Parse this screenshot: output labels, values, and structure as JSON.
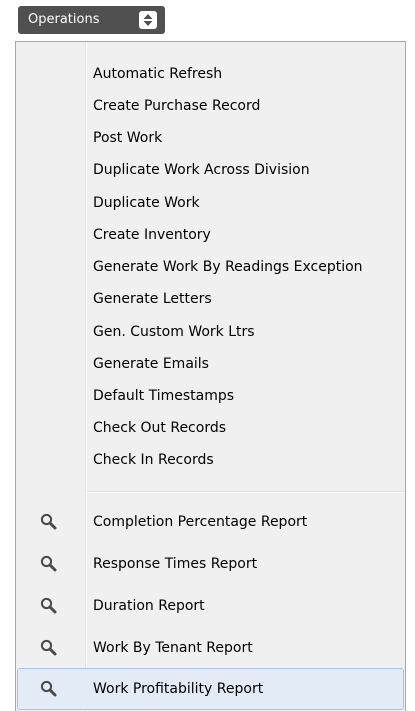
{
  "operations_button": {
    "label": "Operations",
    "icon": "updown-arrows-icon"
  },
  "menu": {
    "actions": [
      {
        "label": "Automatic Refresh"
      },
      {
        "label": "Create Purchase Record"
      },
      {
        "label": "Post Work"
      },
      {
        "label": "Duplicate Work Across Division"
      },
      {
        "label": "Duplicate Work"
      },
      {
        "label": "Create Inventory"
      },
      {
        "label": "Generate Work By Readings Exception"
      },
      {
        "label": "Generate Letters"
      },
      {
        "label": "Gen. Custom Work Ltrs"
      },
      {
        "label": "Generate Emails"
      },
      {
        "label": "Default Timestamps"
      },
      {
        "label": "Check Out Records"
      },
      {
        "label": "Check In Records"
      }
    ],
    "reports": [
      {
        "label": "Completion Percentage Report",
        "icon": "magnifier-icon"
      },
      {
        "label": "Response Times Report",
        "icon": "magnifier-icon"
      },
      {
        "label": "Duration Report",
        "icon": "magnifier-icon"
      },
      {
        "label": "Work By Tenant Report",
        "icon": "magnifier-icon"
      },
      {
        "label": "Work Profitability Report",
        "icon": "magnifier-icon",
        "highlighted": true
      }
    ]
  },
  "colors": {
    "button_bg": "#505050",
    "menu_bg": "#f0f0f0",
    "menu_border": "#a9a9a9",
    "highlight_bg": "#e3ecf6",
    "highlight_border": "#a8c5e9",
    "icon_color": "#4a4a4a"
  }
}
